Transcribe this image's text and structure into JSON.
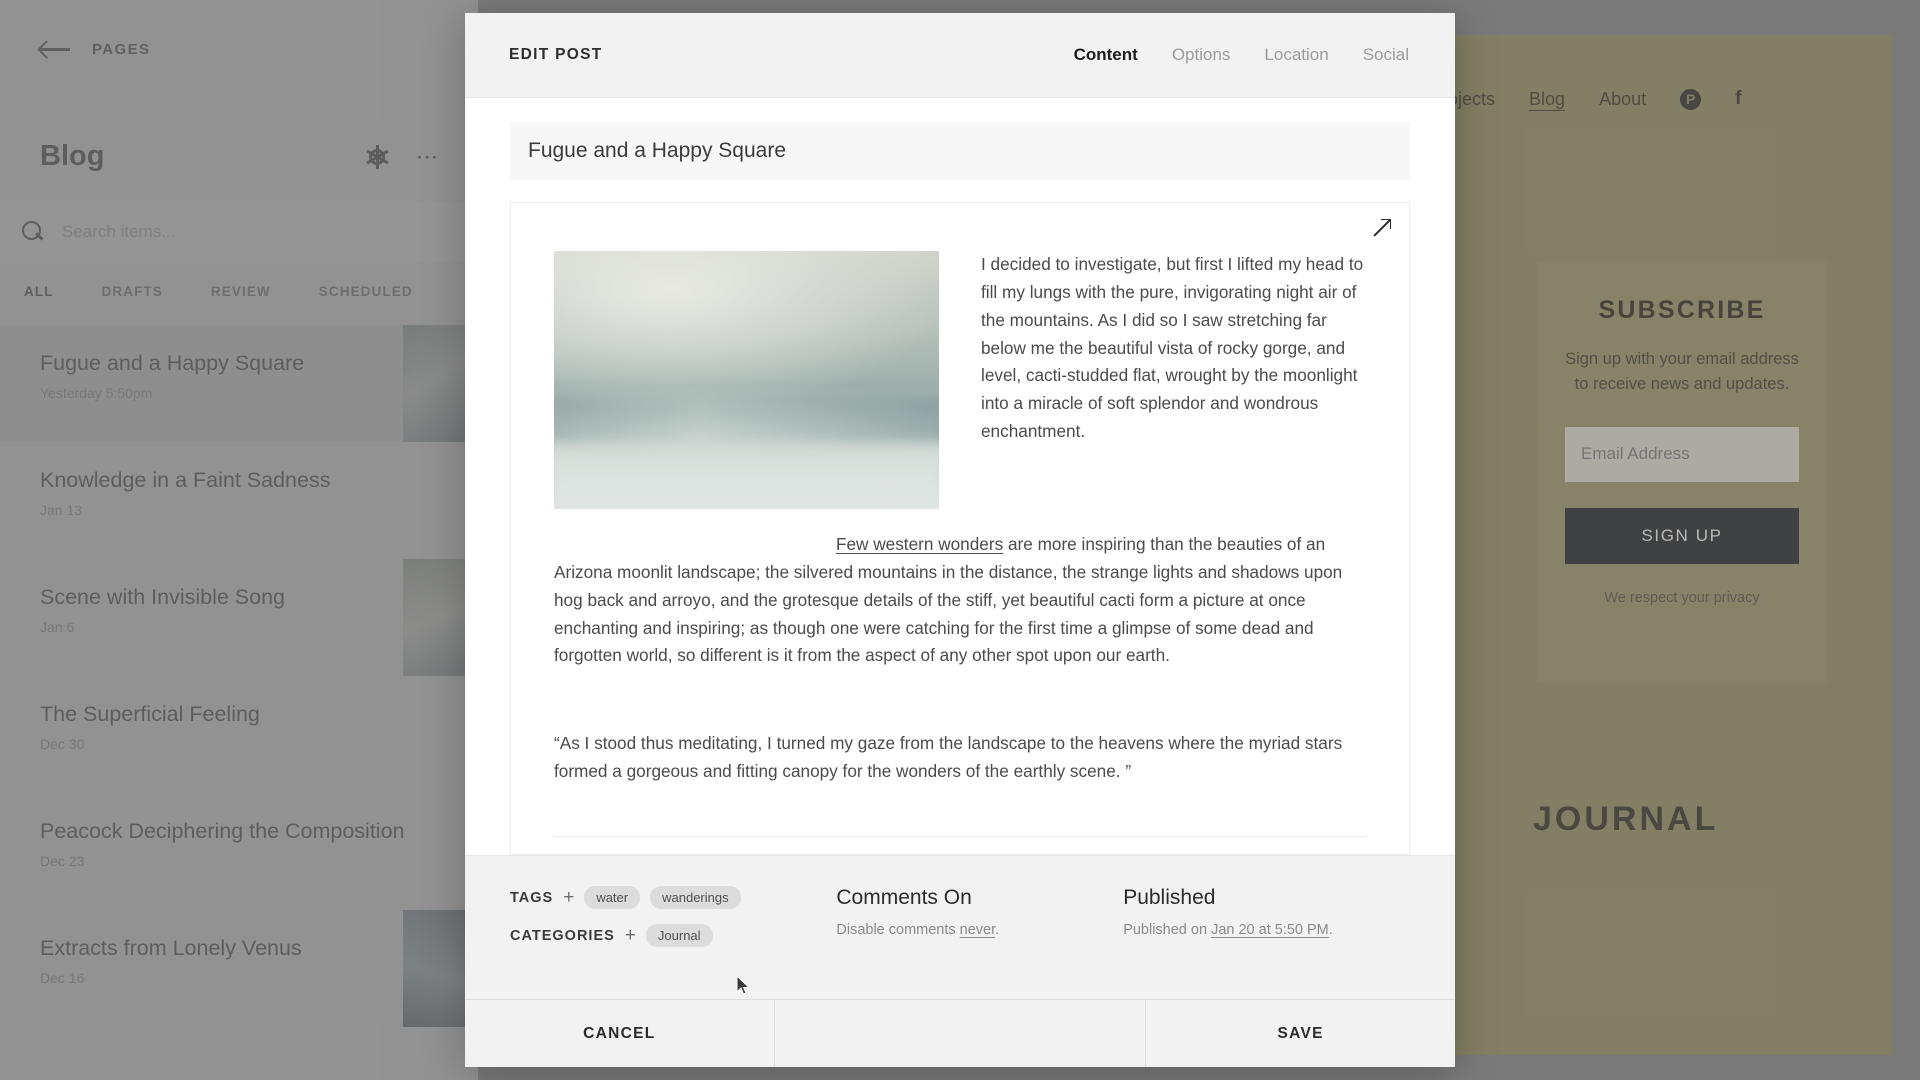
{
  "cms": {
    "back_label": "PAGES",
    "section_title": "Blog",
    "search_placeholder": "Search items...",
    "filter_tabs": [
      "ALL",
      "DRAFTS",
      "REVIEW",
      "SCHEDULED"
    ],
    "posts": [
      {
        "title": "Fugue and a Happy Square",
        "date": "Yesterday 5:50pm"
      },
      {
        "title": "Knowledge in a Faint Sadness",
        "date": "Jan 13"
      },
      {
        "title": "Scene with Invisible Song",
        "date": "Jan 6"
      },
      {
        "title": "The Superficial Feeling",
        "date": "Dec 30"
      },
      {
        "title": "Peacock Deciphering the Composition",
        "date": "Dec 23"
      },
      {
        "title": "Extracts from Lonely Venus",
        "date": "Dec 16"
      }
    ]
  },
  "site": {
    "nav": [
      "Projects",
      "Blog",
      "About"
    ],
    "pinterest_glyph": "P",
    "facebook_glyph": "f",
    "subscribe": {
      "title": "SUBSCRIBE",
      "description": "Sign up with your email address to receive news and updates.",
      "email_placeholder": "Email Address",
      "button_label": "SIGN UP",
      "privacy": "We respect your privacy"
    },
    "journal_heading": "JOURNAL"
  },
  "modal": {
    "title": "EDIT POST",
    "tabs": [
      {
        "label": "Content",
        "active": true
      },
      {
        "label": "Options",
        "active": false
      },
      {
        "label": "Location",
        "active": false
      },
      {
        "label": "Social",
        "active": false
      }
    ],
    "post_title": "Fugue and a Happy Square",
    "body": {
      "paragraph_1": "I decided to investigate, but first I lifted my head to fill my lungs with the pure, invigorating night air of the mountains. As I did so I saw stretching far below me the beautiful vista of rocky gorge, and level, cacti-studded flat, wrought by the moonlight into a miracle of soft splendor and wondrous enchantment.",
      "link_text": "Few western wonders",
      "paragraph_2": " are more inspiring than the beauties of an Arizona moonlit landscape; the silvered mountains in the distance, the strange lights and shadows upon hog back and arroyo, and the grotesque details of the stiff, yet beautiful cacti form a picture at once enchanting and inspiring; as though one were catching for the first time a glimpse of some dead and forgotten world, so different is it from the aspect of any other spot upon our earth.",
      "quote": "“As I stood thus meditating, I turned my gaze from the landscape to the heavens where the myriad stars formed a gorgeous and fitting canopy for the wonders of the earthly scene. ”"
    },
    "meta": {
      "tags_label": "TAGS",
      "tags": [
        "water",
        "wanderings"
      ],
      "categories_label": "CATEGORIES",
      "categories": [
        "Journal"
      ],
      "comments_heading": "Comments On",
      "comments_sub_prefix": "Disable comments ",
      "comments_sub_link": "never",
      "comments_sub_suffix": ".",
      "published_heading": "Published",
      "published_sub_prefix": "Published on ",
      "published_sub_link": "Jan 20 at 5:50 PM",
      "published_sub_suffix": "."
    },
    "actions": {
      "cancel": "CANCEL",
      "save": "SAVE"
    }
  },
  "colors": {
    "modal_header": "#f2f2f2",
    "site_accent": "#8f8757",
    "signup_button": "#15161b",
    "chip": "#dcdcdc"
  }
}
